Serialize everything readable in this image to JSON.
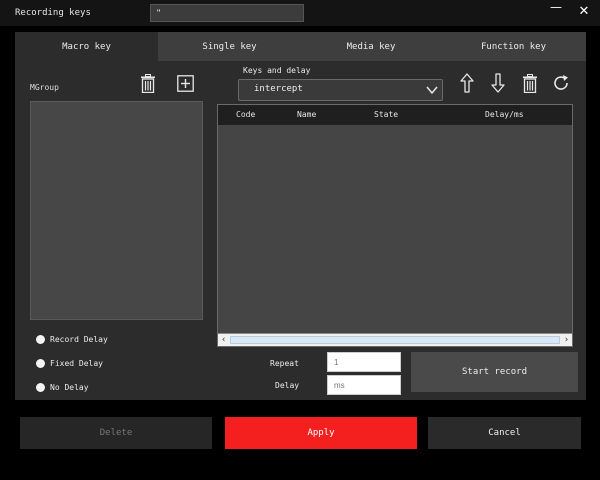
{
  "window": {
    "title": "Recording keys",
    "title_input_value": "\"",
    "minimize_glyph": "—",
    "close_glyph": "✕"
  },
  "tabs": [
    {
      "label": "Macro key",
      "active": true
    },
    {
      "label": "Single key",
      "active": false
    },
    {
      "label": "Media key",
      "active": false
    },
    {
      "label": "Function key",
      "active": false
    }
  ],
  "mgroup": {
    "label": "MGroup",
    "delete_icon": "trash-icon",
    "add_icon": "plus-square-icon"
  },
  "delay_options": [
    {
      "label": "Record Delay"
    },
    {
      "label": "Fixed Delay"
    },
    {
      "label": "No Delay"
    }
  ],
  "keys_and_delay": {
    "label": "Keys and delay",
    "selected": "intercept",
    "icons": [
      "arrow-up-icon",
      "arrow-down-icon",
      "trash-icon",
      "refresh-icon"
    ]
  },
  "table": {
    "columns": [
      "Code",
      "Name",
      "State",
      "Delay/ms"
    ],
    "rows": []
  },
  "repeat": {
    "label": "Repeat",
    "placeholder": "1"
  },
  "delay": {
    "label": "Delay",
    "placeholder": "ms"
  },
  "start_record_label": "Start record",
  "footer": {
    "delete_label": "Delete",
    "apply_label": "Apply",
    "cancel_label": "Cancel"
  },
  "colors": {
    "apply": "#f42020",
    "background": "#2c2c2c",
    "tab_bar": "#3e3e3e"
  }
}
